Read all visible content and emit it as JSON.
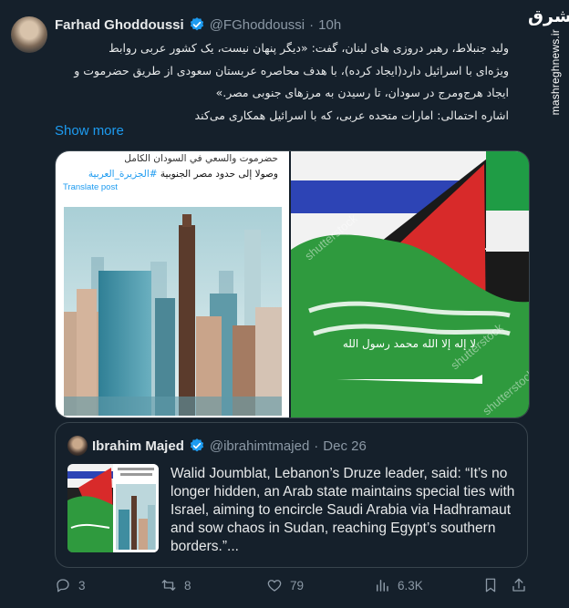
{
  "watermark": {
    "logo": "مشرق",
    "site": "mashreghnews.ir"
  },
  "tweet": {
    "author_name": "Farhad Ghoddoussi",
    "handle": "@FGhoddoussi",
    "separator": "·",
    "time": "10h",
    "body_lines": [
      "ولید جنبلاط، رهبر دروزی های لبنان، گفت: «دیگر پنهان نیست، یک کشور عربی روابط",
      "ویژه‌ای با اسرائیل دارد(ایجاد کرده)، با هدف محاصره عربستان سعودی از طریق حضرموت و",
      "ایجاد هرج‌ومرج در سودان، تا رسیدن به مرزهای جنوبی مصر.»",
      "اشاره احتمالی: امارات متحده عربی، که با اسرائیل همکاری می‌کند"
    ],
    "show_more": "Show more"
  },
  "media": {
    "left_line_1": "حضرموت والسعي في السودان الكامل",
    "left_line_2_text": "وصولا إلى حدود مصر الجنوبية ",
    "left_line_2_tag": "#الجزيرة_العربية",
    "translate_label": "Translate post",
    "stock_watermark": "shutterstock",
    "banner_text": "لا إله إلا الله محمد رسول الله"
  },
  "quote": {
    "author_name": "Ibrahim Majed",
    "handle": "@ibrahimtmajed",
    "separator": "·",
    "date": "Dec 26",
    "text": "Walid Joumblat, Lebanon’s Druze leader, said: “It’s no longer hidden, an Arab state maintains special ties with Israel, aiming to encircle Saudi Arabia via Hadhramaut and sow chaos in Sudan, reaching Egypt’s southern borders.”..."
  },
  "actions": {
    "replies": "3",
    "reposts": "8",
    "likes": "79",
    "views": "6.3K"
  },
  "icons": {
    "verified": "verified-badge-icon",
    "reply": "reply-icon",
    "repost": "repost-icon",
    "like": "heart-icon",
    "views": "views-chart-icon",
    "bookmark": "bookmark-icon",
    "share": "share-icon"
  },
  "colors": {
    "background": "#15202b",
    "accent": "#1d9bf0",
    "muted": "#8b98a5",
    "border": "#38444d"
  }
}
